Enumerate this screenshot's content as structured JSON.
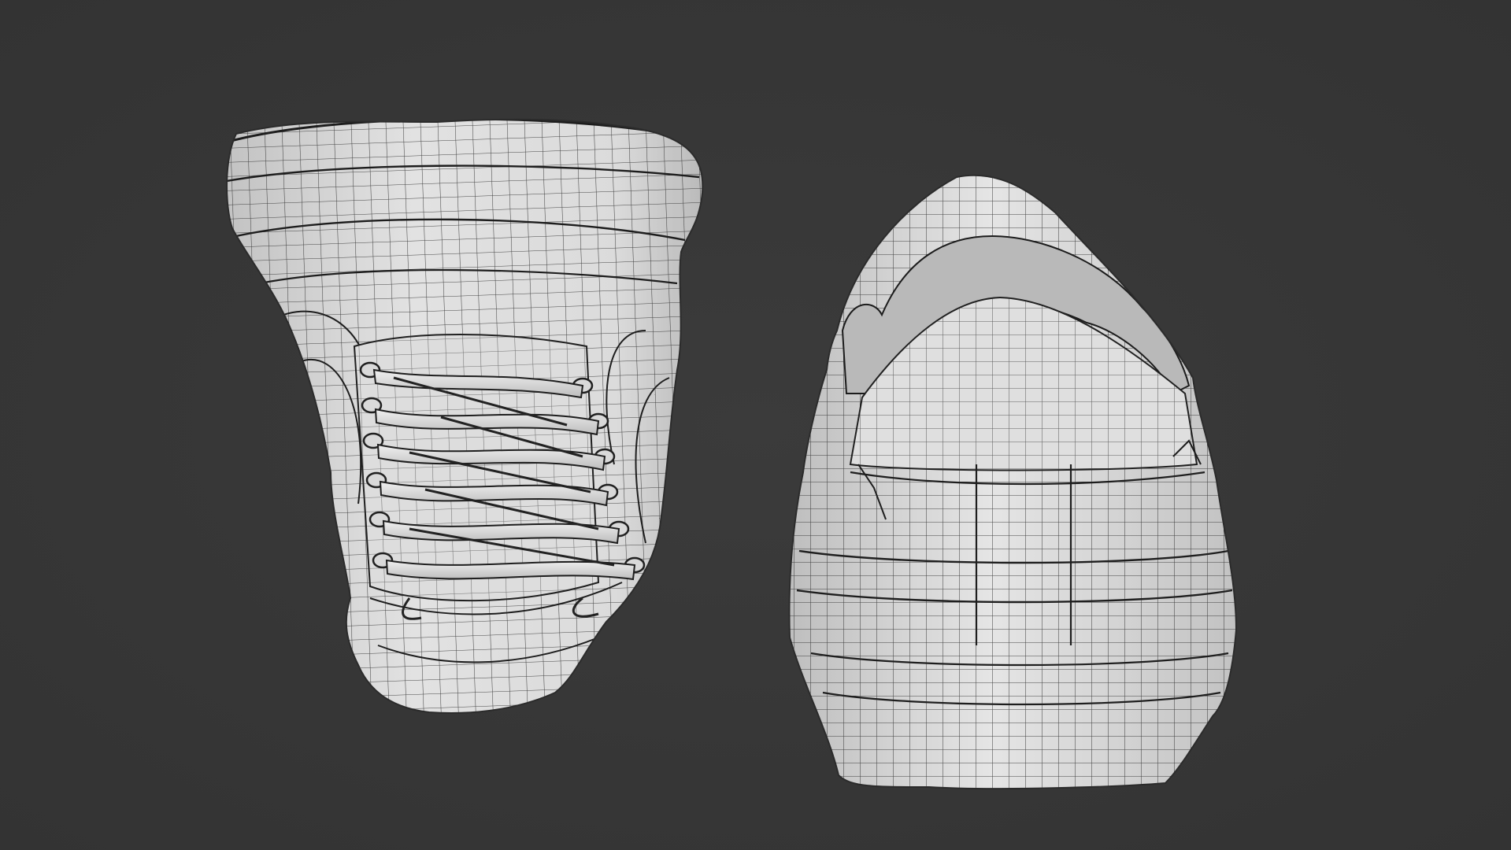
{
  "scene": {
    "background_color": "#373737",
    "mesh_fill_color": "#e9e9e9",
    "wire_color": "#1c1c1c"
  },
  "models": [
    {
      "name": "sneaker-top-view",
      "view": "top-down",
      "shows_laces": true,
      "eyelets_per_side": 6
    },
    {
      "name": "sneaker-back-view",
      "view": "rear",
      "shows_laces": false
    }
  ]
}
